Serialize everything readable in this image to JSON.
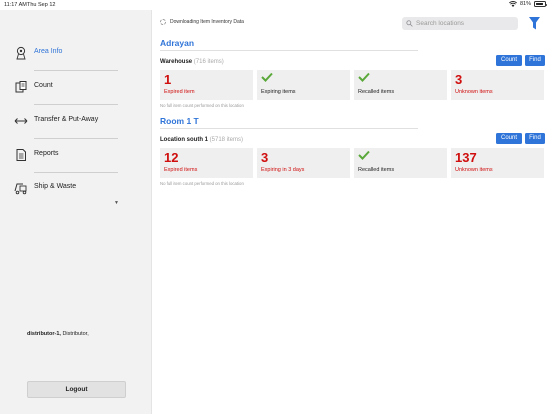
{
  "status_bar": {
    "time": "11:17 AM",
    "date": "Thu Sep 12",
    "battery": "81%",
    "battery_level": 0.81
  },
  "sidebar": {
    "items": [
      {
        "label": "Area Info",
        "icon": "area-info-icon",
        "active": true
      },
      {
        "label": "Count",
        "icon": "count-icon",
        "active": false
      },
      {
        "label": "Transfer & Put-Away",
        "icon": "transfer-icon",
        "active": false
      },
      {
        "label": "Reports",
        "icon": "reports-icon",
        "active": false
      },
      {
        "label": "Ship & Waste",
        "icon": "ship-waste-icon",
        "active": false
      }
    ],
    "user_name": "distributor-1,",
    "user_role": " Distributor,",
    "logout_label": "Logout"
  },
  "main": {
    "download_status": "Downloading Item Inventory Data",
    "search": {
      "placeholder": "Search locations",
      "value": ""
    },
    "sites": [
      {
        "title": "Adrayan",
        "location": "Warehouse",
        "location_count": "(716 items)",
        "count_label": "Count",
        "find_label": "Find",
        "cards": [
          {
            "value": "1",
            "label": "Expired item",
            "check": false
          },
          {
            "value": "",
            "label": "Expiring items",
            "check": true
          },
          {
            "value": "",
            "label": "Recalled items",
            "check": true
          },
          {
            "value": "3",
            "label": "Unknown items",
            "check": false
          }
        ],
        "note": "No full item count performed on this location"
      },
      {
        "title": "Room 1 T",
        "location": "Location south 1",
        "location_count": "(5718 items)",
        "count_label": "Count",
        "find_label": "Find",
        "cards": [
          {
            "value": "12",
            "label": "Expired items",
            "check": false
          },
          {
            "value": "3",
            "label": "Expiring in 3 days",
            "check": false
          },
          {
            "value": "",
            "label": "Recalled items",
            "check": true
          },
          {
            "value": "137",
            "label": "Unknown items",
            "check": false
          }
        ],
        "note": "No full item count performed on this location"
      }
    ]
  },
  "colors": {
    "accent": "#2f74d8",
    "alert": "#d00e0e",
    "ok": "#5aa83a",
    "sidebar_bg": "#f2f2f2",
    "card_bg": "#efefef"
  }
}
